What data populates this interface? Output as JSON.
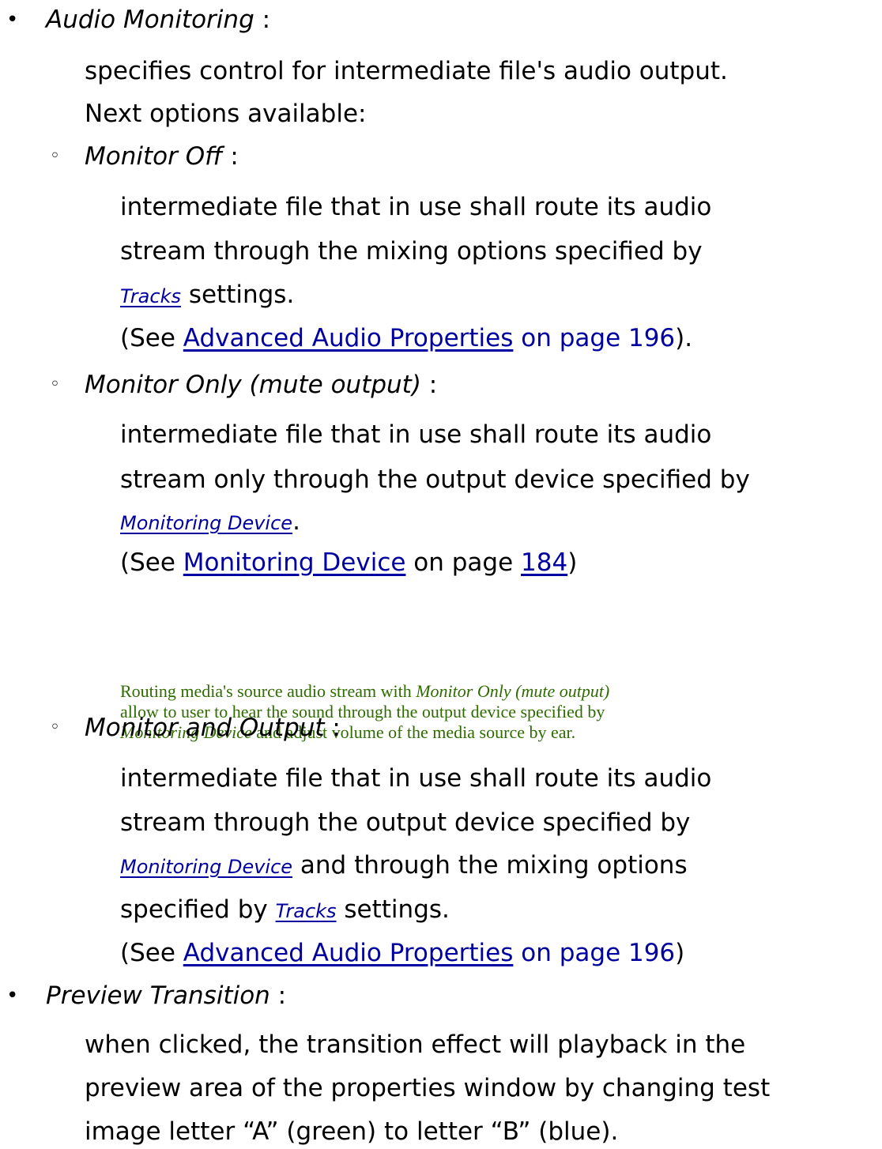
{
  "audio_monitoring": {
    "bullet": "•",
    "term": "Audio Monitoring",
    "sep": " :",
    "desc_line1": "specifies control for intermediate file's audio output.",
    "desc_line2": "Next options available:"
  },
  "monitor_off": {
    "bullet": "◦",
    "term": "Monitor Off",
    "sep": " :",
    "line1": "intermediate file that in use shall route its audio",
    "line2": "stream through the mixing options specified by",
    "link_tracks": "Tracks",
    "line3_rest": " settings.",
    "see_open": "(See ",
    "see_link": "Advanced Audio Properties",
    "see_page": " on page 196",
    "see_close": ")."
  },
  "monitor_only": {
    "bullet": "◦",
    "term": "Monitor Only (mute output)",
    "sep": " :",
    "line1": "intermediate file that in use shall route its audio",
    "line2": "stream only through the output device specified by",
    "link_device": "Monitoring Device",
    "line3_rest": ".",
    "see_open": "(See ",
    "see_link": "Monitoring Device",
    "see_mid": " on page ",
    "see_page": "184",
    "see_close": ")",
    "note_l1_a": "Routing media's source audio stream with ",
    "note_l1_b": "Monitor Only (mute output)",
    "note_l2": "allow to user to hear the sound through the output device specified by",
    "note_l3_a": "Monitoring Device",
    "note_l3_b": " and adjust volume of the media source by ear."
  },
  "monitor_and_output": {
    "bullet": "◦",
    "term": "Monitor and Output",
    "sep": " :",
    "line1": "intermediate file that in use shall route its audio",
    "line2": "stream through the output device specified by",
    "link_device": "Monitoring Device",
    "line3_rest": " and through the mixing options",
    "line4_a": "specified by ",
    "link_tracks": "Tracks",
    "line4_rest": " settings.",
    "see_open": "(See ",
    "see_link": "Advanced Audio Properties",
    "see_page": " on page 196",
    "see_close": ")"
  },
  "preview_transition": {
    "bullet": "•",
    "term": "Preview Transition",
    "sep": " :",
    "line1": "when clicked, the transition effect will playback in the",
    "line2": "preview area of the properties window by changing test",
    "line3": "image letter “A” (green) to letter “B” (blue)."
  },
  "colors": {
    "link": "#0000a0",
    "note": "#2e6b00",
    "text": "#000000"
  }
}
